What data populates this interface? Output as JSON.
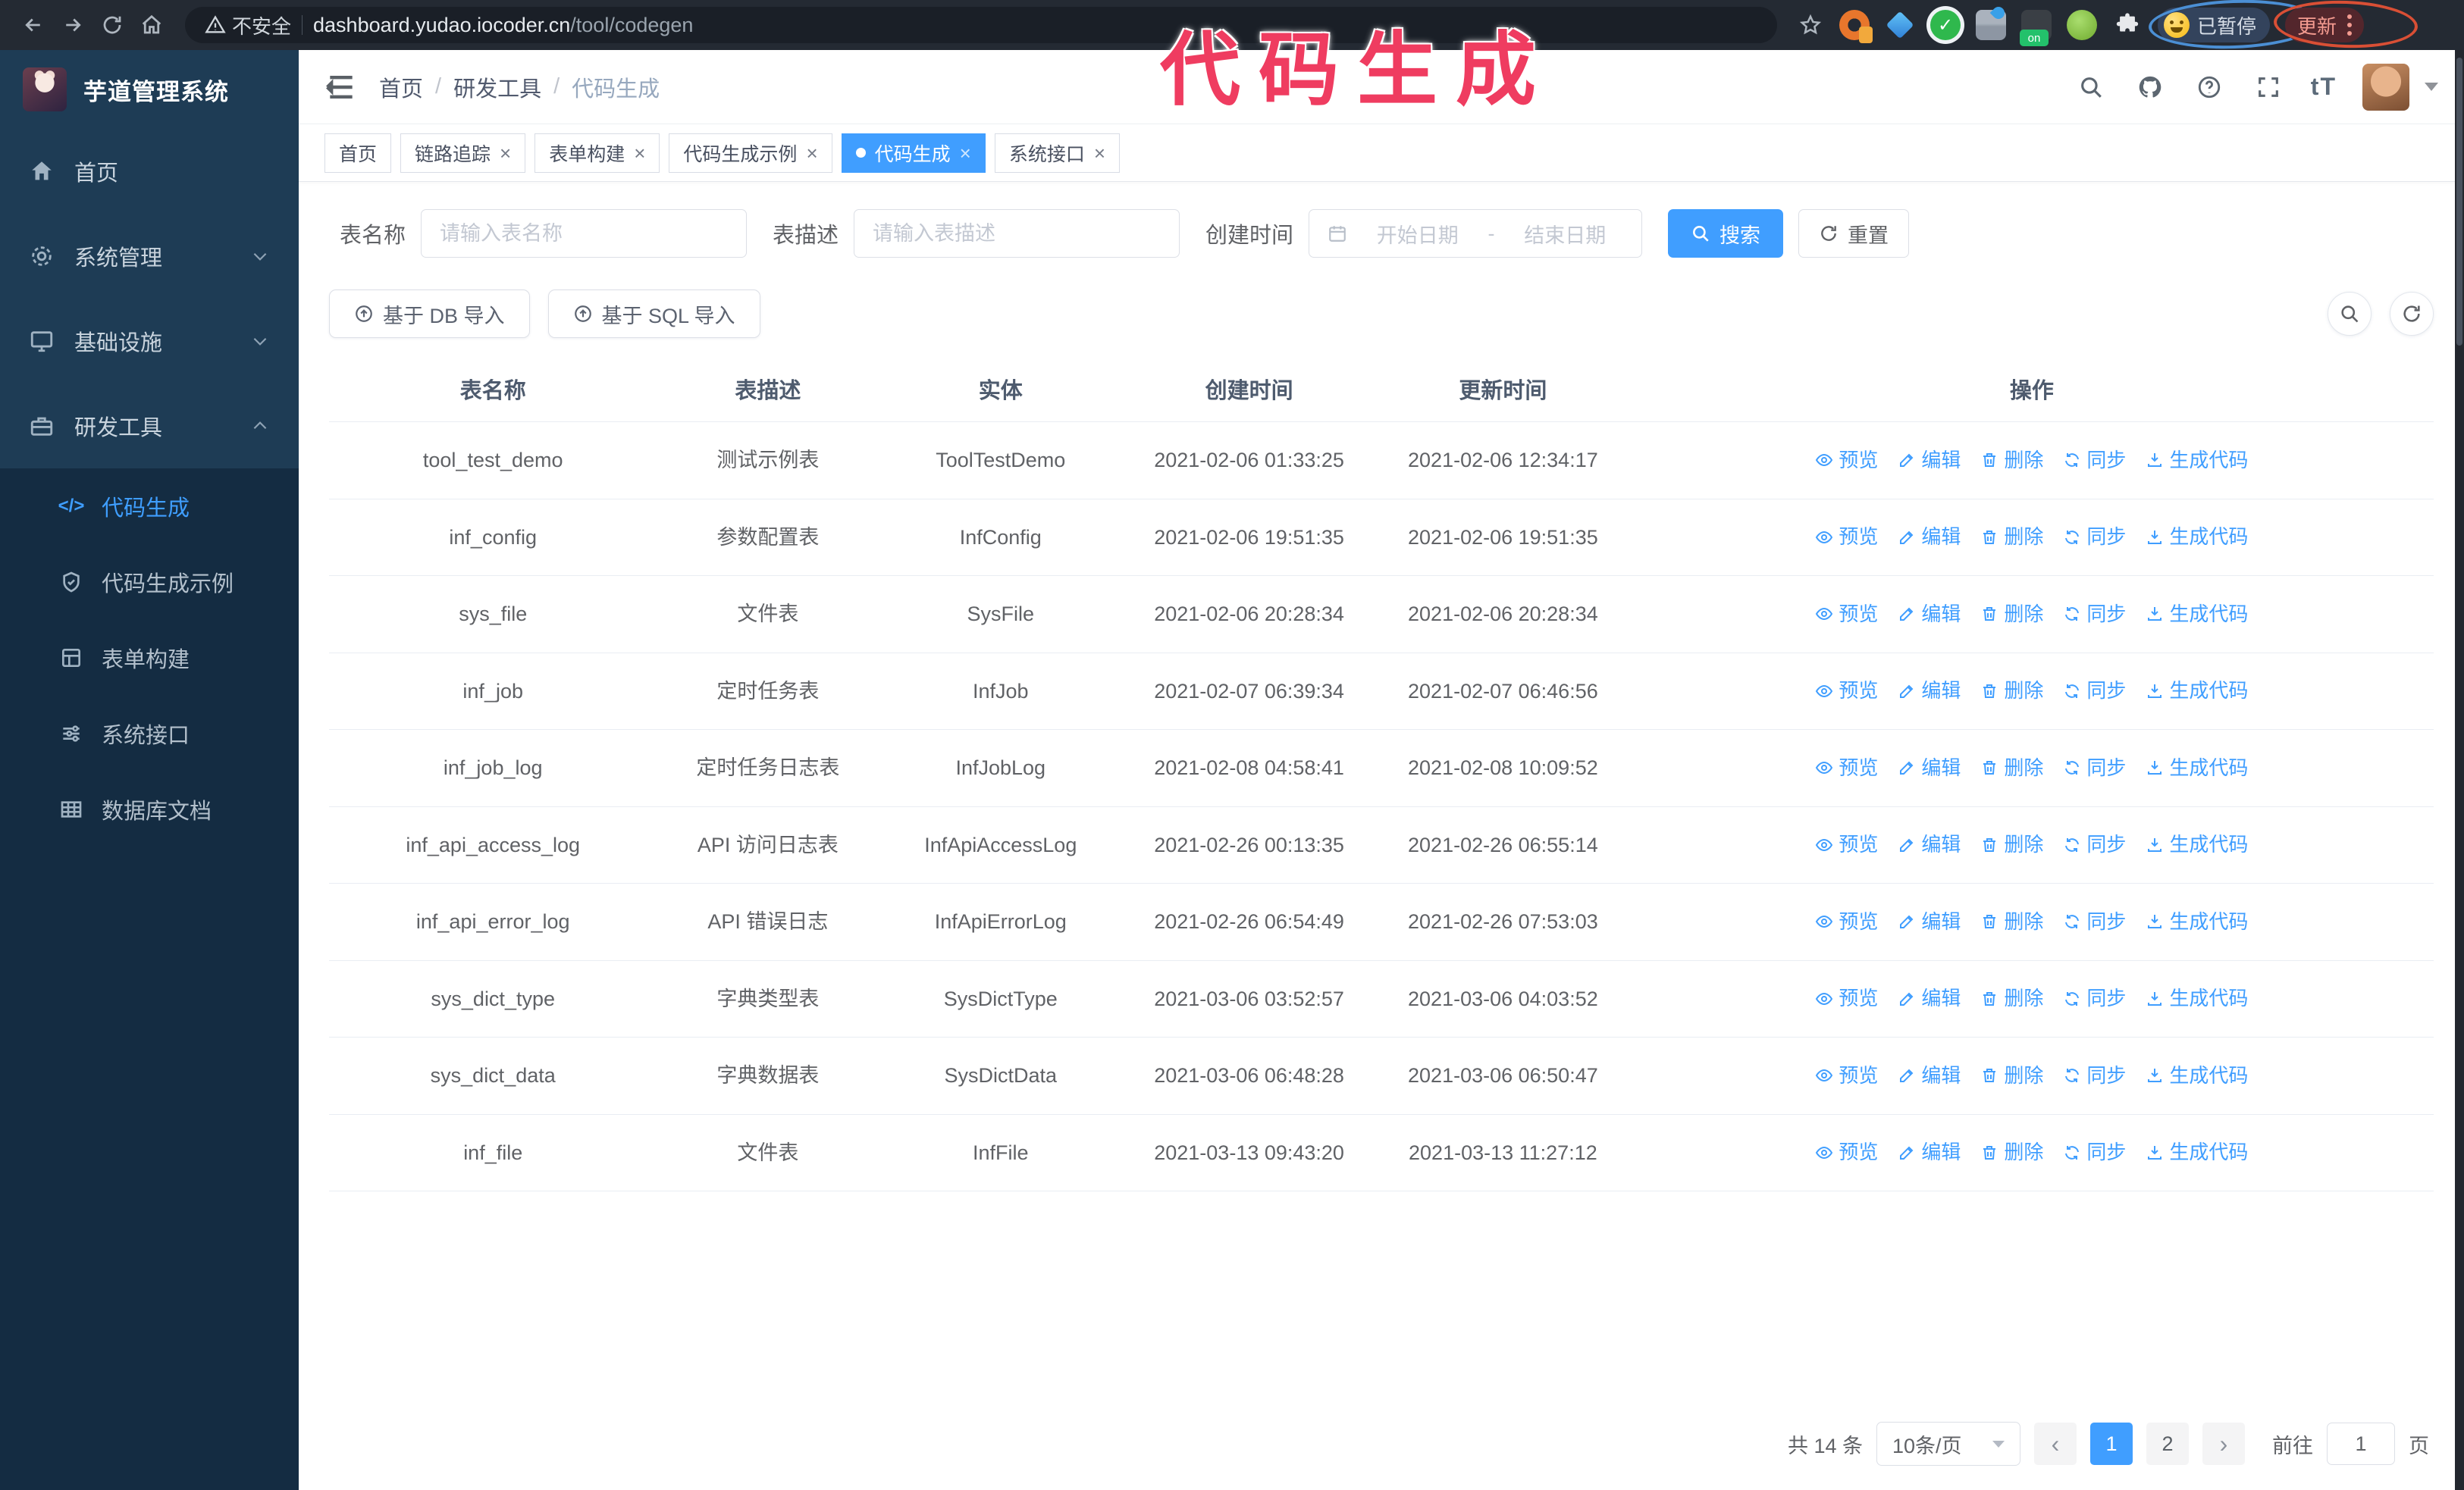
{
  "colors": {
    "accent": "#409eff",
    "annotation_pink": "#ef3c60",
    "sidebar_bg": "#142c42",
    "sidebar_top_bg": "#1e3c55"
  },
  "annotation": {
    "title": "代码生成"
  },
  "browser": {
    "security_warning": "不安全",
    "url_domain": "dashboard.yudao.iocoder.cn",
    "url_path": "/tool/codegen",
    "paused_badge": "已暂停",
    "update_button": "更新"
  },
  "ui": {
    "close_symbol": "×",
    "prev_symbol": "‹",
    "next_symbol": "›",
    "breadcrumb_separator": "/",
    "code_icon_text": "</>",
    "font_size_icon_text": "tT"
  },
  "sidebar": {
    "logo_title": "芋道管理系统",
    "items": [
      {
        "label": "首页"
      },
      {
        "label": "系统管理"
      },
      {
        "label": "基础设施"
      },
      {
        "label": "研发工具"
      }
    ],
    "subitems": [
      {
        "label": "代码生成"
      },
      {
        "label": "代码生成示例"
      },
      {
        "label": "表单构建"
      },
      {
        "label": "系统接口"
      },
      {
        "label": "数据库文档"
      }
    ]
  },
  "navbar": {
    "breadcrumb": [
      "首页",
      "研发工具",
      "代码生成"
    ]
  },
  "tabs": [
    {
      "label": "首页"
    },
    {
      "label": "链路追踪"
    },
    {
      "label": "表单构建"
    },
    {
      "label": "代码生成示例"
    },
    {
      "label": "代码生成"
    },
    {
      "label": "系统接口"
    }
  ],
  "search_form": {
    "table_name_label": "表名称",
    "table_name_placeholder": "请输入表名称",
    "table_desc_label": "表描述",
    "table_desc_placeholder": "请输入表描述",
    "create_time_label": "创建时间",
    "date_start_placeholder": "开始日期",
    "date_separator": "-",
    "date_end_placeholder": "结束日期",
    "search_label": "搜索",
    "reset_label": "重置"
  },
  "toolbar": {
    "import_db_label": "基于 DB 导入",
    "import_sql_label": "基于 SQL 导入"
  },
  "table": {
    "columns": [
      "表名称",
      "表描述",
      "实体",
      "创建时间",
      "更新时间",
      "操作"
    ],
    "actions": [
      "预览",
      "编辑",
      "删除",
      "同步",
      "生成代码"
    ],
    "rows": [
      {
        "name": "tool_test_demo",
        "desc": "测试示例表",
        "entity": "ToolTestDemo",
        "create_time": "2021-02-06 01:33:25",
        "update_time": "2021-02-06 12:34:17"
      },
      {
        "name": "inf_config",
        "desc": "参数配置表",
        "entity": "InfConfig",
        "create_time": "2021-02-06 19:51:35",
        "update_time": "2021-02-06 19:51:35"
      },
      {
        "name": "sys_file",
        "desc": "文件表",
        "entity": "SysFile",
        "create_time": "2021-02-06 20:28:34",
        "update_time": "2021-02-06 20:28:34"
      },
      {
        "name": "inf_job",
        "desc": "定时任务表",
        "entity": "InfJob",
        "create_time": "2021-02-07 06:39:34",
        "update_time": "2021-02-07 06:46:56"
      },
      {
        "name": "inf_job_log",
        "desc": "定时任务日志表",
        "entity": "InfJobLog",
        "create_time": "2021-02-08 04:58:41",
        "update_time": "2021-02-08 10:09:52"
      },
      {
        "name": "inf_api_access_log",
        "desc": "API 访问日志表",
        "entity": "InfApiAccessLog",
        "create_time": "2021-02-26 00:13:35",
        "update_time": "2021-02-26 06:55:14"
      },
      {
        "name": "inf_api_error_log",
        "desc": "API 错误日志",
        "entity": "InfApiErrorLog",
        "create_time": "2021-02-26 06:54:49",
        "update_time": "2021-02-26 07:53:03"
      },
      {
        "name": "sys_dict_type",
        "desc": "字典类型表",
        "entity": "SysDictType",
        "create_time": "2021-03-06 03:52:57",
        "update_time": "2021-03-06 04:03:52"
      },
      {
        "name": "sys_dict_data",
        "desc": "字典数据表",
        "entity": "SysDictData",
        "create_time": "2021-03-06 06:48:28",
        "update_time": "2021-03-06 06:50:47"
      },
      {
        "name": "inf_file",
        "desc": "文件表",
        "entity": "InfFile",
        "create_time": "2021-03-13 09:43:20",
        "update_time": "2021-03-13 11:27:12"
      }
    ]
  },
  "pagination": {
    "total_text": "共 14 条",
    "page_size": "10条/页",
    "pages": [
      "1",
      "2"
    ],
    "active_page": "1",
    "goto_label": "前往",
    "goto_value": "1",
    "page_suffix": "页"
  }
}
